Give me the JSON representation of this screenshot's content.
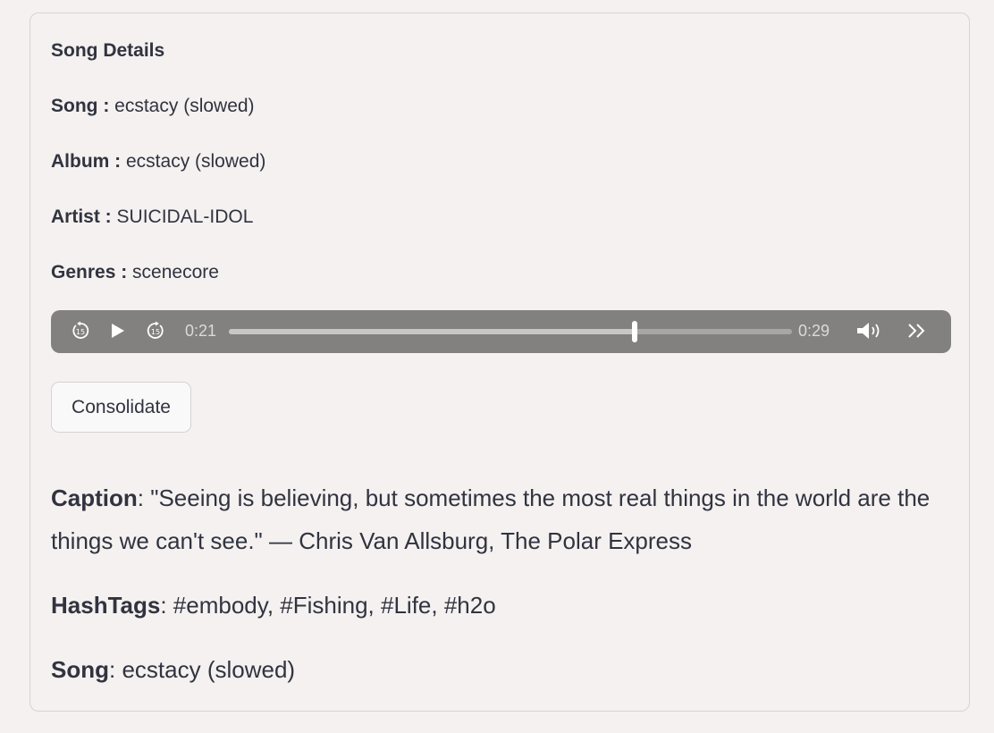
{
  "details": {
    "heading": "Song Details",
    "song_label": "Song :",
    "song_value": "ecstacy (slowed)",
    "album_label": "Album :",
    "album_value": "ecstacy (slowed)",
    "artist_label": "Artist :",
    "artist_value": "SUICIDAL-IDOL",
    "genres_label": "Genres :",
    "genres_value": "scenecore"
  },
  "player": {
    "current_time": "0:21",
    "duration": "0:29",
    "progress": 0.72,
    "icons": [
      "rewind-15-icon",
      "play-icon",
      "forward-15-icon",
      "volume-icon",
      "more-icon"
    ]
  },
  "button": {
    "label": "Consolidate"
  },
  "output": {
    "caption_label": "Caption",
    "caption_value": "\"Seeing is believing, but sometimes the most real things in the world are the things we can't see.\" — Chris Van Allsburg, The Polar Express",
    "hashtags_label": "HashTags",
    "hashtags_value": "#embody, #Fishing, #Life, #h2o",
    "song_label": "Song",
    "song_value": "ecstacy (slowed)"
  },
  "colors": {
    "background": "#f4f1f0",
    "player": "#838180",
    "text": "#31333f"
  }
}
